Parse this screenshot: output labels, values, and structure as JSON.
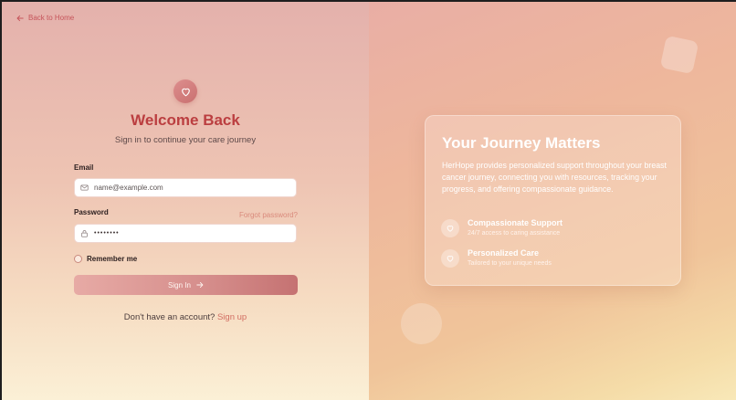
{
  "nav": {
    "back_label": "Back to Home"
  },
  "login": {
    "title": "Welcome Back",
    "subtitle": "Sign in to continue your care journey",
    "email_label": "Email",
    "email_placeholder": "name@example.com",
    "password_label": "Password",
    "password_value": "••••••••",
    "forgot_label": "Forgot password?",
    "remember_label": "Remember me",
    "signin_label": "Sign In",
    "no_account_text": "Don't have an account?",
    "signup_label": "Sign up"
  },
  "info_card": {
    "title": "Your Journey Matters",
    "description": "HerHope provides personalized support throughout your breast cancer journey, connecting you with resources, tracking your progress, and offering compassionate guidance.",
    "features": [
      {
        "icon": "heart-icon",
        "title": "Compassionate Support",
        "subtitle": "24/7 access to caring assistance"
      },
      {
        "icon": "heart-icon",
        "title": "Personalized Care",
        "subtitle": "Tailored to your unique needs"
      }
    ]
  },
  "colors": {
    "accent": "#c6545a",
    "title": "#bb3e40",
    "button_start": "#e7aaa5",
    "button_end": "#c57272"
  }
}
